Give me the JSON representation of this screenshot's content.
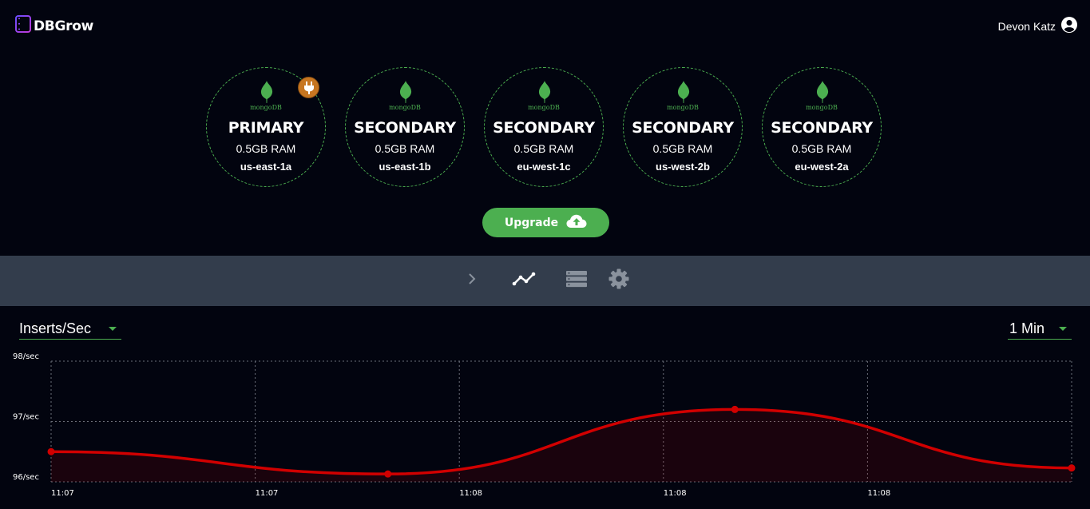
{
  "app": {
    "name": "DBGrow"
  },
  "user": {
    "name": "Devon Katz"
  },
  "nodes": [
    {
      "logo_text": "mongoDB",
      "role": "PRIMARY",
      "ram": "0.5GB RAM",
      "region": "us-east-1a"
    },
    {
      "logo_text": "mongoDB",
      "role": "SECONDARY",
      "ram": "0.5GB RAM",
      "region": "us-east-1b"
    },
    {
      "logo_text": "mongoDB",
      "role": "SECONDARY",
      "ram": "0.5GB RAM",
      "region": "eu-west-1c"
    },
    {
      "logo_text": "mongoDB",
      "role": "SECONDARY",
      "ram": "0.5GB RAM",
      "region": "us-west-2b"
    },
    {
      "logo_text": "mongoDB",
      "role": "SECONDARY",
      "ram": "0.5GB RAM",
      "region": "eu-west-2a"
    }
  ],
  "upgrade_button": {
    "label": "Upgrade"
  },
  "toolbar": {
    "items": [
      "chevron-right-icon",
      "line-chart-icon",
      "server-list-icon",
      "gear-icon"
    ],
    "active": "line-chart-icon"
  },
  "metric_select": {
    "value": "Inserts/Sec"
  },
  "range_select": {
    "value": "1 Min"
  },
  "colors": {
    "accent": "#4caf50",
    "series": "#d10000",
    "background": "#02040f",
    "toolbar": "#333d4c",
    "plug": "#c77621"
  },
  "chart_data": {
    "type": "line",
    "x_tick_labels": [
      "11:07",
      "11:07",
      "11:08",
      "11:08",
      "11:08"
    ],
    "y_tick_labels": [
      "98/sec",
      "97/sec",
      "96/sec"
    ],
    "y_ticks": [
      98,
      97,
      96
    ],
    "ylim": [
      96,
      98
    ],
    "points": [
      {
        "x": 0.0,
        "y": 96.5
      },
      {
        "x": 1.65,
        "y": 96.13
      },
      {
        "x": 3.35,
        "y": 97.2
      },
      {
        "x": 5.0,
        "y": 96.23
      }
    ],
    "xlim": [
      0,
      5
    ],
    "grid": true,
    "fill_area": true
  }
}
